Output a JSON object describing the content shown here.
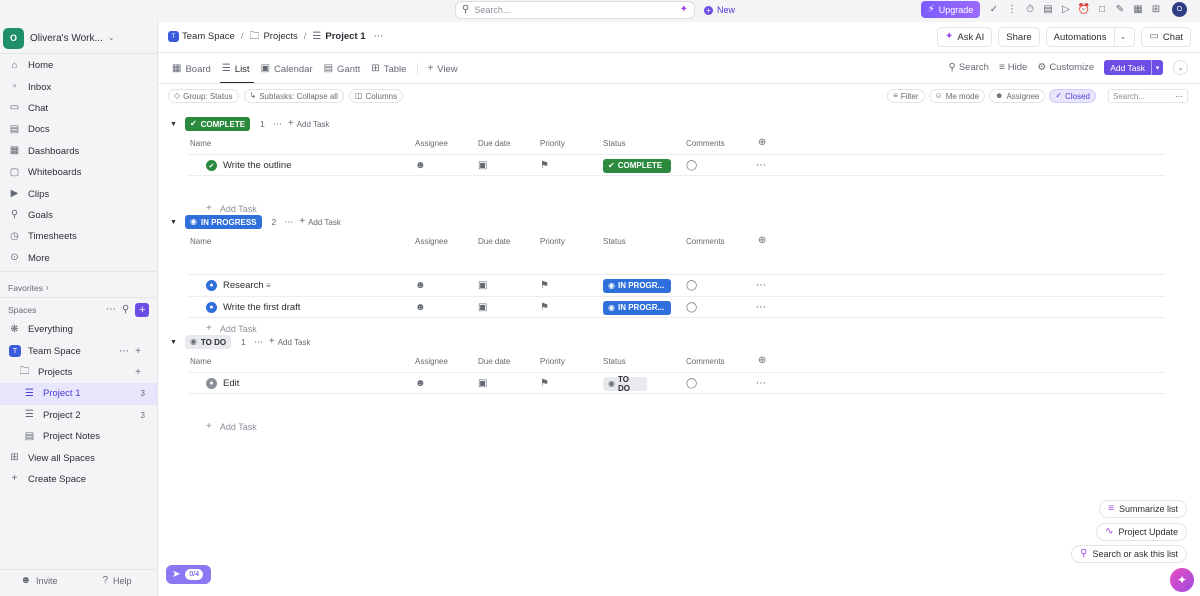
{
  "topbar": {
    "search_placeholder": "Search...",
    "new_label": "New",
    "upgrade_label": "Upgrade",
    "avatar_initial": "O"
  },
  "sidebar": {
    "workspace": {
      "initial": "O",
      "name": "Olivera's Work..."
    },
    "nav": [
      {
        "label": "Home",
        "icon": "home-icon"
      },
      {
        "label": "Inbox",
        "icon": "inbox-icon"
      },
      {
        "label": "Chat",
        "icon": "chat-icon"
      },
      {
        "label": "Docs",
        "icon": "docs-icon"
      },
      {
        "label": "Dashboards",
        "icon": "dashboard-icon"
      },
      {
        "label": "Whiteboards",
        "icon": "whiteboard-icon"
      },
      {
        "label": "Clips",
        "icon": "clips-icon"
      },
      {
        "label": "Goals",
        "icon": "goals-icon"
      },
      {
        "label": "Timesheets",
        "icon": "timesheet-icon"
      },
      {
        "label": "More",
        "icon": "more-icon"
      }
    ],
    "favorites_label": "Favorites",
    "spaces_label": "Spaces",
    "spaces": {
      "everything": "Everything",
      "team_space": "Team Space",
      "team_initial": "T",
      "projects": "Projects",
      "project1": "Project 1",
      "project1_count": "3",
      "project2": "Project 2",
      "project2_count": "3",
      "project_notes": "Project Notes",
      "view_all": "View all Spaces",
      "create": "Create Space"
    },
    "invite_label": "Invite",
    "help_label": "Help"
  },
  "header": {
    "crumb1": "Team Space",
    "crumb2": "Projects",
    "crumb3": "Project 1",
    "ask_ai": "Ask AI",
    "share": "Share",
    "automations": "Automations",
    "chat": "Chat"
  },
  "tabs": {
    "board": "Board",
    "list": "List",
    "calendar": "Calendar",
    "gantt": "Gantt",
    "table": "Table",
    "view": "View",
    "search": "Search",
    "hide": "Hide",
    "customize": "Customize",
    "add_task": "Add Task"
  },
  "filters": {
    "group": "Group: Status",
    "subtasks": "Subtasks: Collapse all",
    "columns": "Columns",
    "filter": "Filter",
    "me_mode": "Me mode",
    "assignee": "Assignee",
    "closed": "Closed",
    "search_placeholder": "Search..."
  },
  "columns": {
    "name": "Name",
    "assignee": "Assignee",
    "due": "Due date",
    "priority": "Priority",
    "status": "Status",
    "comments": "Comments"
  },
  "groups": [
    {
      "label": "COMPLETE",
      "color": "#2b8a3e",
      "count": "1",
      "tasks": [
        {
          "name": "Write the outline",
          "status": "COMPLETE"
        }
      ]
    },
    {
      "label": "IN PROGRESS",
      "color": "#2f6fdc",
      "count": "2",
      "tasks": [
        {
          "name": "Research",
          "status": "IN PROGR..."
        },
        {
          "name": "Write the first draft",
          "status": "IN PROGR..."
        }
      ]
    },
    {
      "label": "TO DO",
      "color": "#e9eaee",
      "count": "1",
      "tasks": [
        {
          "name": "Edit",
          "status": "TO DO"
        }
      ]
    }
  ],
  "add_task_label": "Add Task",
  "add_task_row_label": "Add Task",
  "floating": {
    "summarize": "Summarize list",
    "project_update": "Project Update",
    "search_ask": "Search or ask this list",
    "rocket_badge": "0/4"
  }
}
